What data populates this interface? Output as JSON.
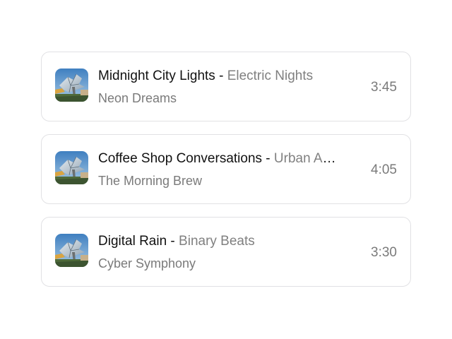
{
  "tracks": [
    {
      "title": "Midnight City Lights",
      "separator": " - ",
      "artist": "Electric Nights",
      "album": "Neon Dreams",
      "duration": "3:45",
      "artwork_icon": "album-artwork"
    },
    {
      "title": "Coffee Shop Conversations",
      "separator": " - ",
      "artist": "Urban Acoustics",
      "album": "The Morning Brew",
      "duration": "4:05",
      "artwork_icon": "album-artwork"
    },
    {
      "title": "Digital Rain",
      "separator": " - ",
      "artist": "Binary Beats",
      "album": "Cyber Symphony",
      "duration": "3:30",
      "artwork_icon": "album-artwork"
    }
  ]
}
